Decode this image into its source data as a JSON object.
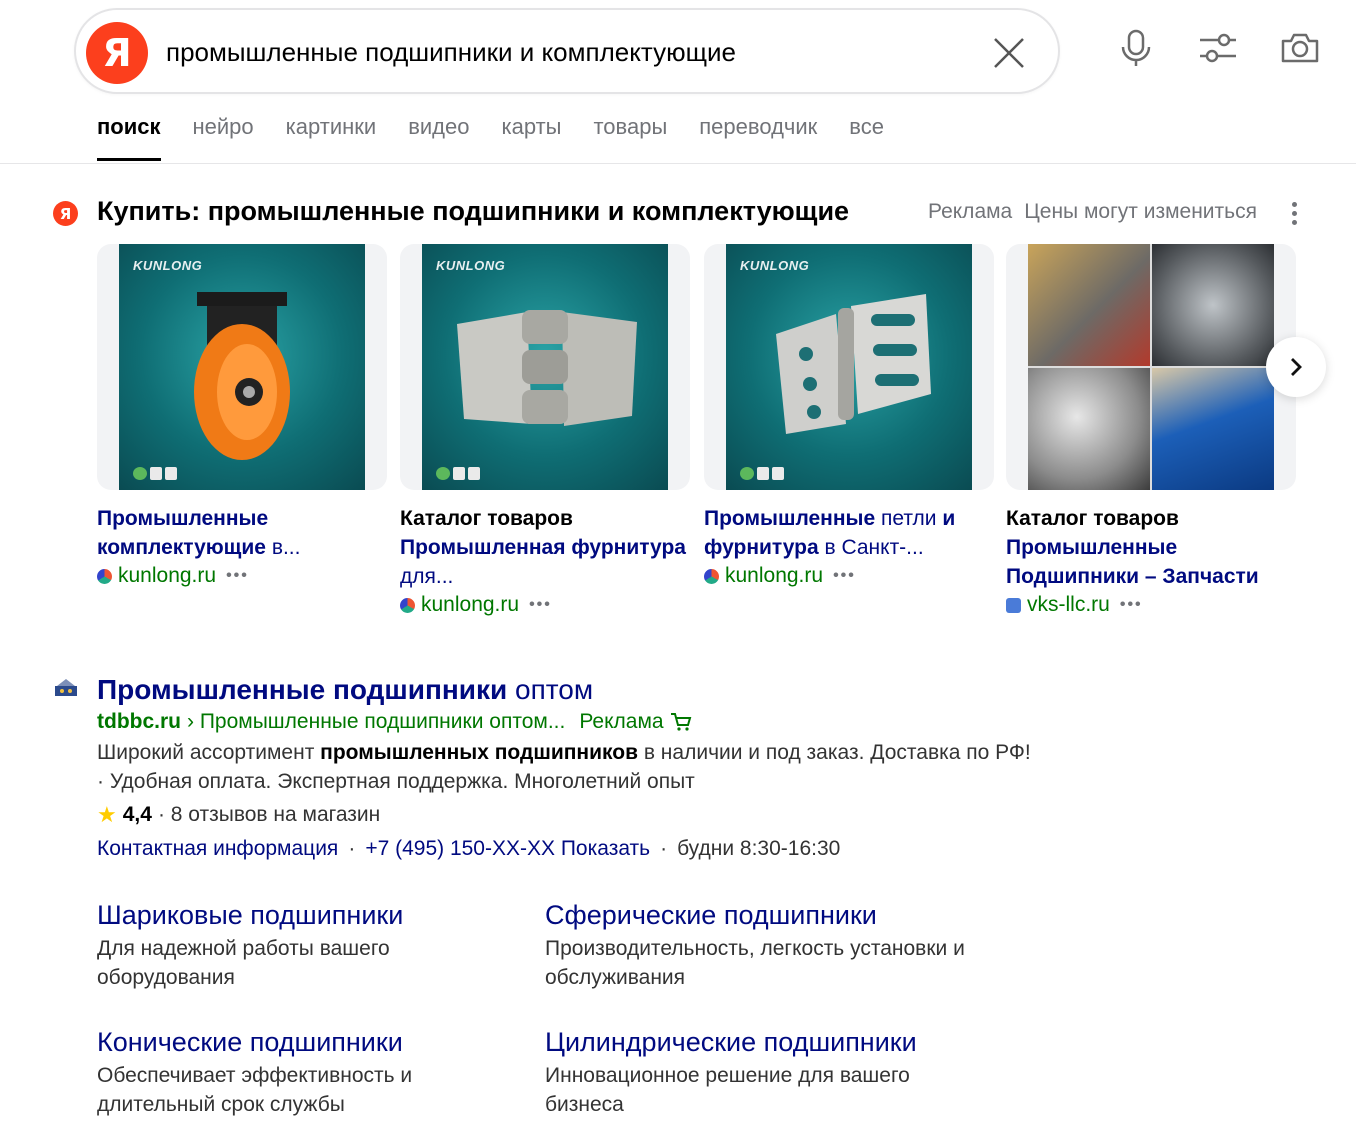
{
  "search": {
    "logo_letter": "Я",
    "query": "промышленные подшипники и комплектующие"
  },
  "tabs": [
    {
      "label": "поиск",
      "active": true
    },
    {
      "label": "нейро"
    },
    {
      "label": "картинки"
    },
    {
      "label": "видео"
    },
    {
      "label": "карты"
    },
    {
      "label": "товары"
    },
    {
      "label": "переводчик"
    },
    {
      "label": "все"
    }
  ],
  "shopping": {
    "icon_letter": "Я",
    "title": "Купить: промышленные подшипники и комплектующие",
    "ad_label": "Реклама",
    "price_note": "Цены могут измениться",
    "cards": [
      {
        "brand": "KUNLONG",
        "title_bold": "Промышленные комплектующие",
        "title_rest": " в...",
        "source": "kunlong.ru",
        "dots": "•••"
      },
      {
        "brand": "KUNLONG",
        "title_lead": "Каталог товаров",
        "title_bold": "Промышленная фурнитура",
        "title_rest": " для...",
        "source": "kunlong.ru",
        "dots": "•••"
      },
      {
        "brand": "KUNLONG",
        "title_bold": "Промышленные",
        "title_rest": " петли ",
        "title_bold2": "и фурнитура",
        "title_rest2": " в Санкт-...",
        "source": "kunlong.ru",
        "dots": "•••"
      },
      {
        "title_lead": "Каталог товаров",
        "title_bold": "Промышленные Подшипники – Запчасти",
        "source": "vks-llc.ru",
        "dots": "•••"
      }
    ]
  },
  "result": {
    "title_bold": "Промышленные подшипники",
    "title_rest": " оптом",
    "domain": "tdbbc.ru",
    "breadcrumb": "› Промышленные подшипники оптом...",
    "ad_label": "Реклама",
    "snippet_1": "Широкий ассортимент ",
    "snippet_bold": "промышленных подшипников",
    "snippet_2": " в наличии и под заказ. Доставка по РФ! · Удобная оплата. Экспертная поддержка. Многолетний опыт",
    "rating_value": "4,4",
    "rating_text": "· 8 отзывов на магазин",
    "contact_link": "Контактная информация",
    "sep": "·",
    "phone": "+7 (495) 150-XX-XX Показать",
    "hours": "будни 8:30-16:30",
    "sitelinks": [
      {
        "title": "Шариковые подшипники",
        "desc": "Для надежной работы вашего оборудования"
      },
      {
        "title": "Сферические подшипники",
        "desc": "Производительность, легкость установки и обслуживания"
      },
      {
        "title": "Конические подшипники",
        "desc": "Обеспечивает эффективность и длительный срок службы"
      },
      {
        "title": "Цилиндрические подшипники",
        "desc": "Инновационное решение для вашего бизнеса"
      }
    ]
  },
  "colors": {
    "brand_red": "#fc3f1d",
    "link_blue": "#000a80",
    "url_green": "#007700",
    "muted_gray": "#717378"
  }
}
